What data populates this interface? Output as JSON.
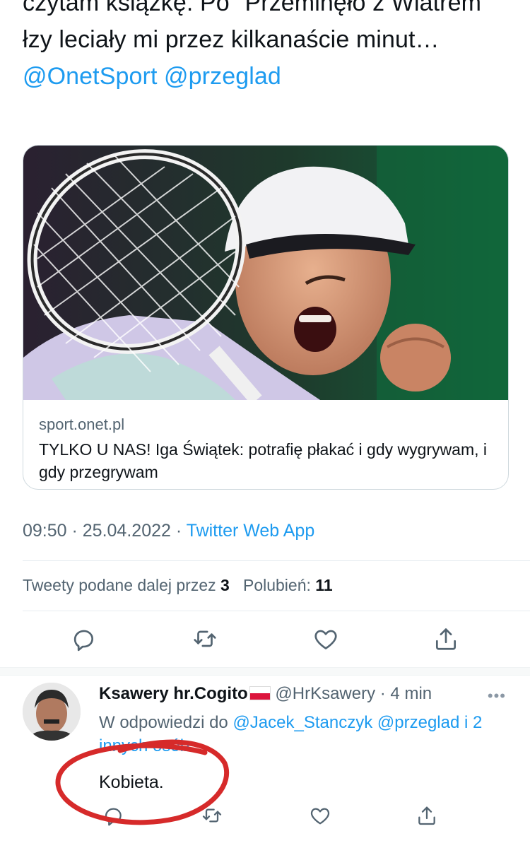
{
  "tweet": {
    "text_plain": "czytam książkę. Po \"Przeminęło z Wiatrem\" łzy leciały mi przez kilkanaście minut…",
    "mention_1": "@OnetSport",
    "mention_2": "@przeglad"
  },
  "card": {
    "domain": "sport.onet.pl",
    "title": "TYLKO U NAS! Iga Świątek: potrafię płakać i gdy wygrywam, i gdy przegrywam"
  },
  "meta": {
    "time_date": "09:50 · 25.04.2022 · ",
    "app": "Twitter Web App"
  },
  "stats": {
    "retweets_label": "Tweety podane dalej przez",
    "retweets_count": "3",
    "likes_label": "Polubień:",
    "likes_count": "11"
  },
  "actions": {
    "reply_icon": "reply-icon",
    "retweet_icon": "retweet-icon",
    "like_icon": "heart-icon",
    "share_icon": "share-icon"
  },
  "reply": {
    "name": "Ksawery hr.Cogito",
    "handle_time": "@HrKsawery · 4 min",
    "more": "•••",
    "replying_prefix": "W odpowiedzi do",
    "replying_mention_1": "@Jacek_Stanczyk",
    "replying_mention_2": "@przeglad",
    "replying_suffix": "i 2 innych osób",
    "body": "Kobieta."
  },
  "colors": {
    "accent": "#1d9bf0",
    "secondary_text": "#536471",
    "annotation": "#d62a2a"
  }
}
